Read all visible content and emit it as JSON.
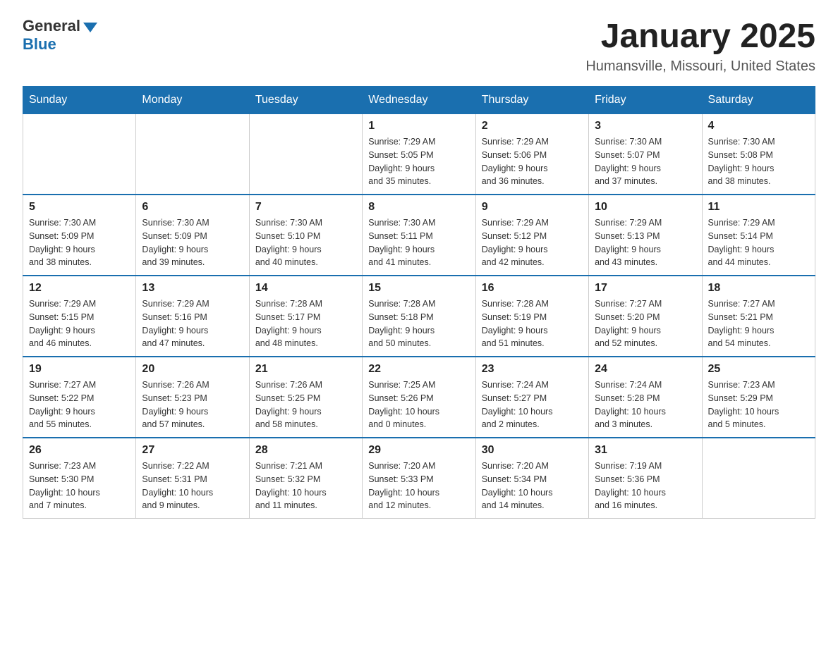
{
  "logo": {
    "general": "General",
    "blue": "Blue"
  },
  "header": {
    "title": "January 2025",
    "subtitle": "Humansville, Missouri, United States"
  },
  "weekdays": [
    "Sunday",
    "Monday",
    "Tuesday",
    "Wednesday",
    "Thursday",
    "Friday",
    "Saturday"
  ],
  "weeks": [
    [
      {
        "day": "",
        "info": ""
      },
      {
        "day": "",
        "info": ""
      },
      {
        "day": "",
        "info": ""
      },
      {
        "day": "1",
        "info": "Sunrise: 7:29 AM\nSunset: 5:05 PM\nDaylight: 9 hours\nand 35 minutes."
      },
      {
        "day": "2",
        "info": "Sunrise: 7:29 AM\nSunset: 5:06 PM\nDaylight: 9 hours\nand 36 minutes."
      },
      {
        "day": "3",
        "info": "Sunrise: 7:30 AM\nSunset: 5:07 PM\nDaylight: 9 hours\nand 37 minutes."
      },
      {
        "day": "4",
        "info": "Sunrise: 7:30 AM\nSunset: 5:08 PM\nDaylight: 9 hours\nand 38 minutes."
      }
    ],
    [
      {
        "day": "5",
        "info": "Sunrise: 7:30 AM\nSunset: 5:09 PM\nDaylight: 9 hours\nand 38 minutes."
      },
      {
        "day": "6",
        "info": "Sunrise: 7:30 AM\nSunset: 5:09 PM\nDaylight: 9 hours\nand 39 minutes."
      },
      {
        "day": "7",
        "info": "Sunrise: 7:30 AM\nSunset: 5:10 PM\nDaylight: 9 hours\nand 40 minutes."
      },
      {
        "day": "8",
        "info": "Sunrise: 7:30 AM\nSunset: 5:11 PM\nDaylight: 9 hours\nand 41 minutes."
      },
      {
        "day": "9",
        "info": "Sunrise: 7:29 AM\nSunset: 5:12 PM\nDaylight: 9 hours\nand 42 minutes."
      },
      {
        "day": "10",
        "info": "Sunrise: 7:29 AM\nSunset: 5:13 PM\nDaylight: 9 hours\nand 43 minutes."
      },
      {
        "day": "11",
        "info": "Sunrise: 7:29 AM\nSunset: 5:14 PM\nDaylight: 9 hours\nand 44 minutes."
      }
    ],
    [
      {
        "day": "12",
        "info": "Sunrise: 7:29 AM\nSunset: 5:15 PM\nDaylight: 9 hours\nand 46 minutes."
      },
      {
        "day": "13",
        "info": "Sunrise: 7:29 AM\nSunset: 5:16 PM\nDaylight: 9 hours\nand 47 minutes."
      },
      {
        "day": "14",
        "info": "Sunrise: 7:28 AM\nSunset: 5:17 PM\nDaylight: 9 hours\nand 48 minutes."
      },
      {
        "day": "15",
        "info": "Sunrise: 7:28 AM\nSunset: 5:18 PM\nDaylight: 9 hours\nand 50 minutes."
      },
      {
        "day": "16",
        "info": "Sunrise: 7:28 AM\nSunset: 5:19 PM\nDaylight: 9 hours\nand 51 minutes."
      },
      {
        "day": "17",
        "info": "Sunrise: 7:27 AM\nSunset: 5:20 PM\nDaylight: 9 hours\nand 52 minutes."
      },
      {
        "day": "18",
        "info": "Sunrise: 7:27 AM\nSunset: 5:21 PM\nDaylight: 9 hours\nand 54 minutes."
      }
    ],
    [
      {
        "day": "19",
        "info": "Sunrise: 7:27 AM\nSunset: 5:22 PM\nDaylight: 9 hours\nand 55 minutes."
      },
      {
        "day": "20",
        "info": "Sunrise: 7:26 AM\nSunset: 5:23 PM\nDaylight: 9 hours\nand 57 minutes."
      },
      {
        "day": "21",
        "info": "Sunrise: 7:26 AM\nSunset: 5:25 PM\nDaylight: 9 hours\nand 58 minutes."
      },
      {
        "day": "22",
        "info": "Sunrise: 7:25 AM\nSunset: 5:26 PM\nDaylight: 10 hours\nand 0 minutes."
      },
      {
        "day": "23",
        "info": "Sunrise: 7:24 AM\nSunset: 5:27 PM\nDaylight: 10 hours\nand 2 minutes."
      },
      {
        "day": "24",
        "info": "Sunrise: 7:24 AM\nSunset: 5:28 PM\nDaylight: 10 hours\nand 3 minutes."
      },
      {
        "day": "25",
        "info": "Sunrise: 7:23 AM\nSunset: 5:29 PM\nDaylight: 10 hours\nand 5 minutes."
      }
    ],
    [
      {
        "day": "26",
        "info": "Sunrise: 7:23 AM\nSunset: 5:30 PM\nDaylight: 10 hours\nand 7 minutes."
      },
      {
        "day": "27",
        "info": "Sunrise: 7:22 AM\nSunset: 5:31 PM\nDaylight: 10 hours\nand 9 minutes."
      },
      {
        "day": "28",
        "info": "Sunrise: 7:21 AM\nSunset: 5:32 PM\nDaylight: 10 hours\nand 11 minutes."
      },
      {
        "day": "29",
        "info": "Sunrise: 7:20 AM\nSunset: 5:33 PM\nDaylight: 10 hours\nand 12 minutes."
      },
      {
        "day": "30",
        "info": "Sunrise: 7:20 AM\nSunset: 5:34 PM\nDaylight: 10 hours\nand 14 minutes."
      },
      {
        "day": "31",
        "info": "Sunrise: 7:19 AM\nSunset: 5:36 PM\nDaylight: 10 hours\nand 16 minutes."
      },
      {
        "day": "",
        "info": ""
      }
    ]
  ]
}
